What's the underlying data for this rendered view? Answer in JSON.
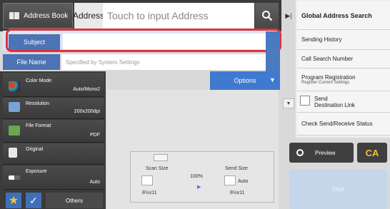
{
  "top": {
    "address_book": "Address Book",
    "address_label": "Address",
    "address_placeholder": "Touch to input Address"
  },
  "subject": {
    "label": "Subject",
    "value": ""
  },
  "filename": {
    "label": "File Name",
    "placeholder": "Specified by System Settings"
  },
  "options": {
    "label": "Options"
  },
  "settings": [
    {
      "title": "Color Mode",
      "value": "Auto/Mono2"
    },
    {
      "title": "Resolution",
      "value": "200x200dpi"
    },
    {
      "title": "File Format",
      "value": "PDF"
    },
    {
      "title": "Original",
      "value": ""
    },
    {
      "title": "Exposure",
      "value": "Auto"
    }
  ],
  "bottom_left": {
    "others": "Others"
  },
  "scan": {
    "scan_size_label": "Scan Size",
    "send_size_label": "Send Size",
    "ratio": "100%",
    "send_size_mode": "Auto",
    "scan_size_value": "8½x11",
    "send_size_value": "8½x11"
  },
  "right_panel": {
    "global": "Global Address Search",
    "history": "Sending History",
    "call_search": "Call Search Number",
    "program": "Program Registration",
    "program_sub": "Register Current Settings",
    "send_dest": "Send\nDestination Link",
    "check_status": "Check Send/Receive Status"
  },
  "actions": {
    "preview": "Preview",
    "ca": "CA",
    "start": "Start"
  },
  "colors": {
    "accent_blue": "#3f7ad0",
    "highlight_red": "#e0303e",
    "ca_yellow": "#f3c13a"
  }
}
